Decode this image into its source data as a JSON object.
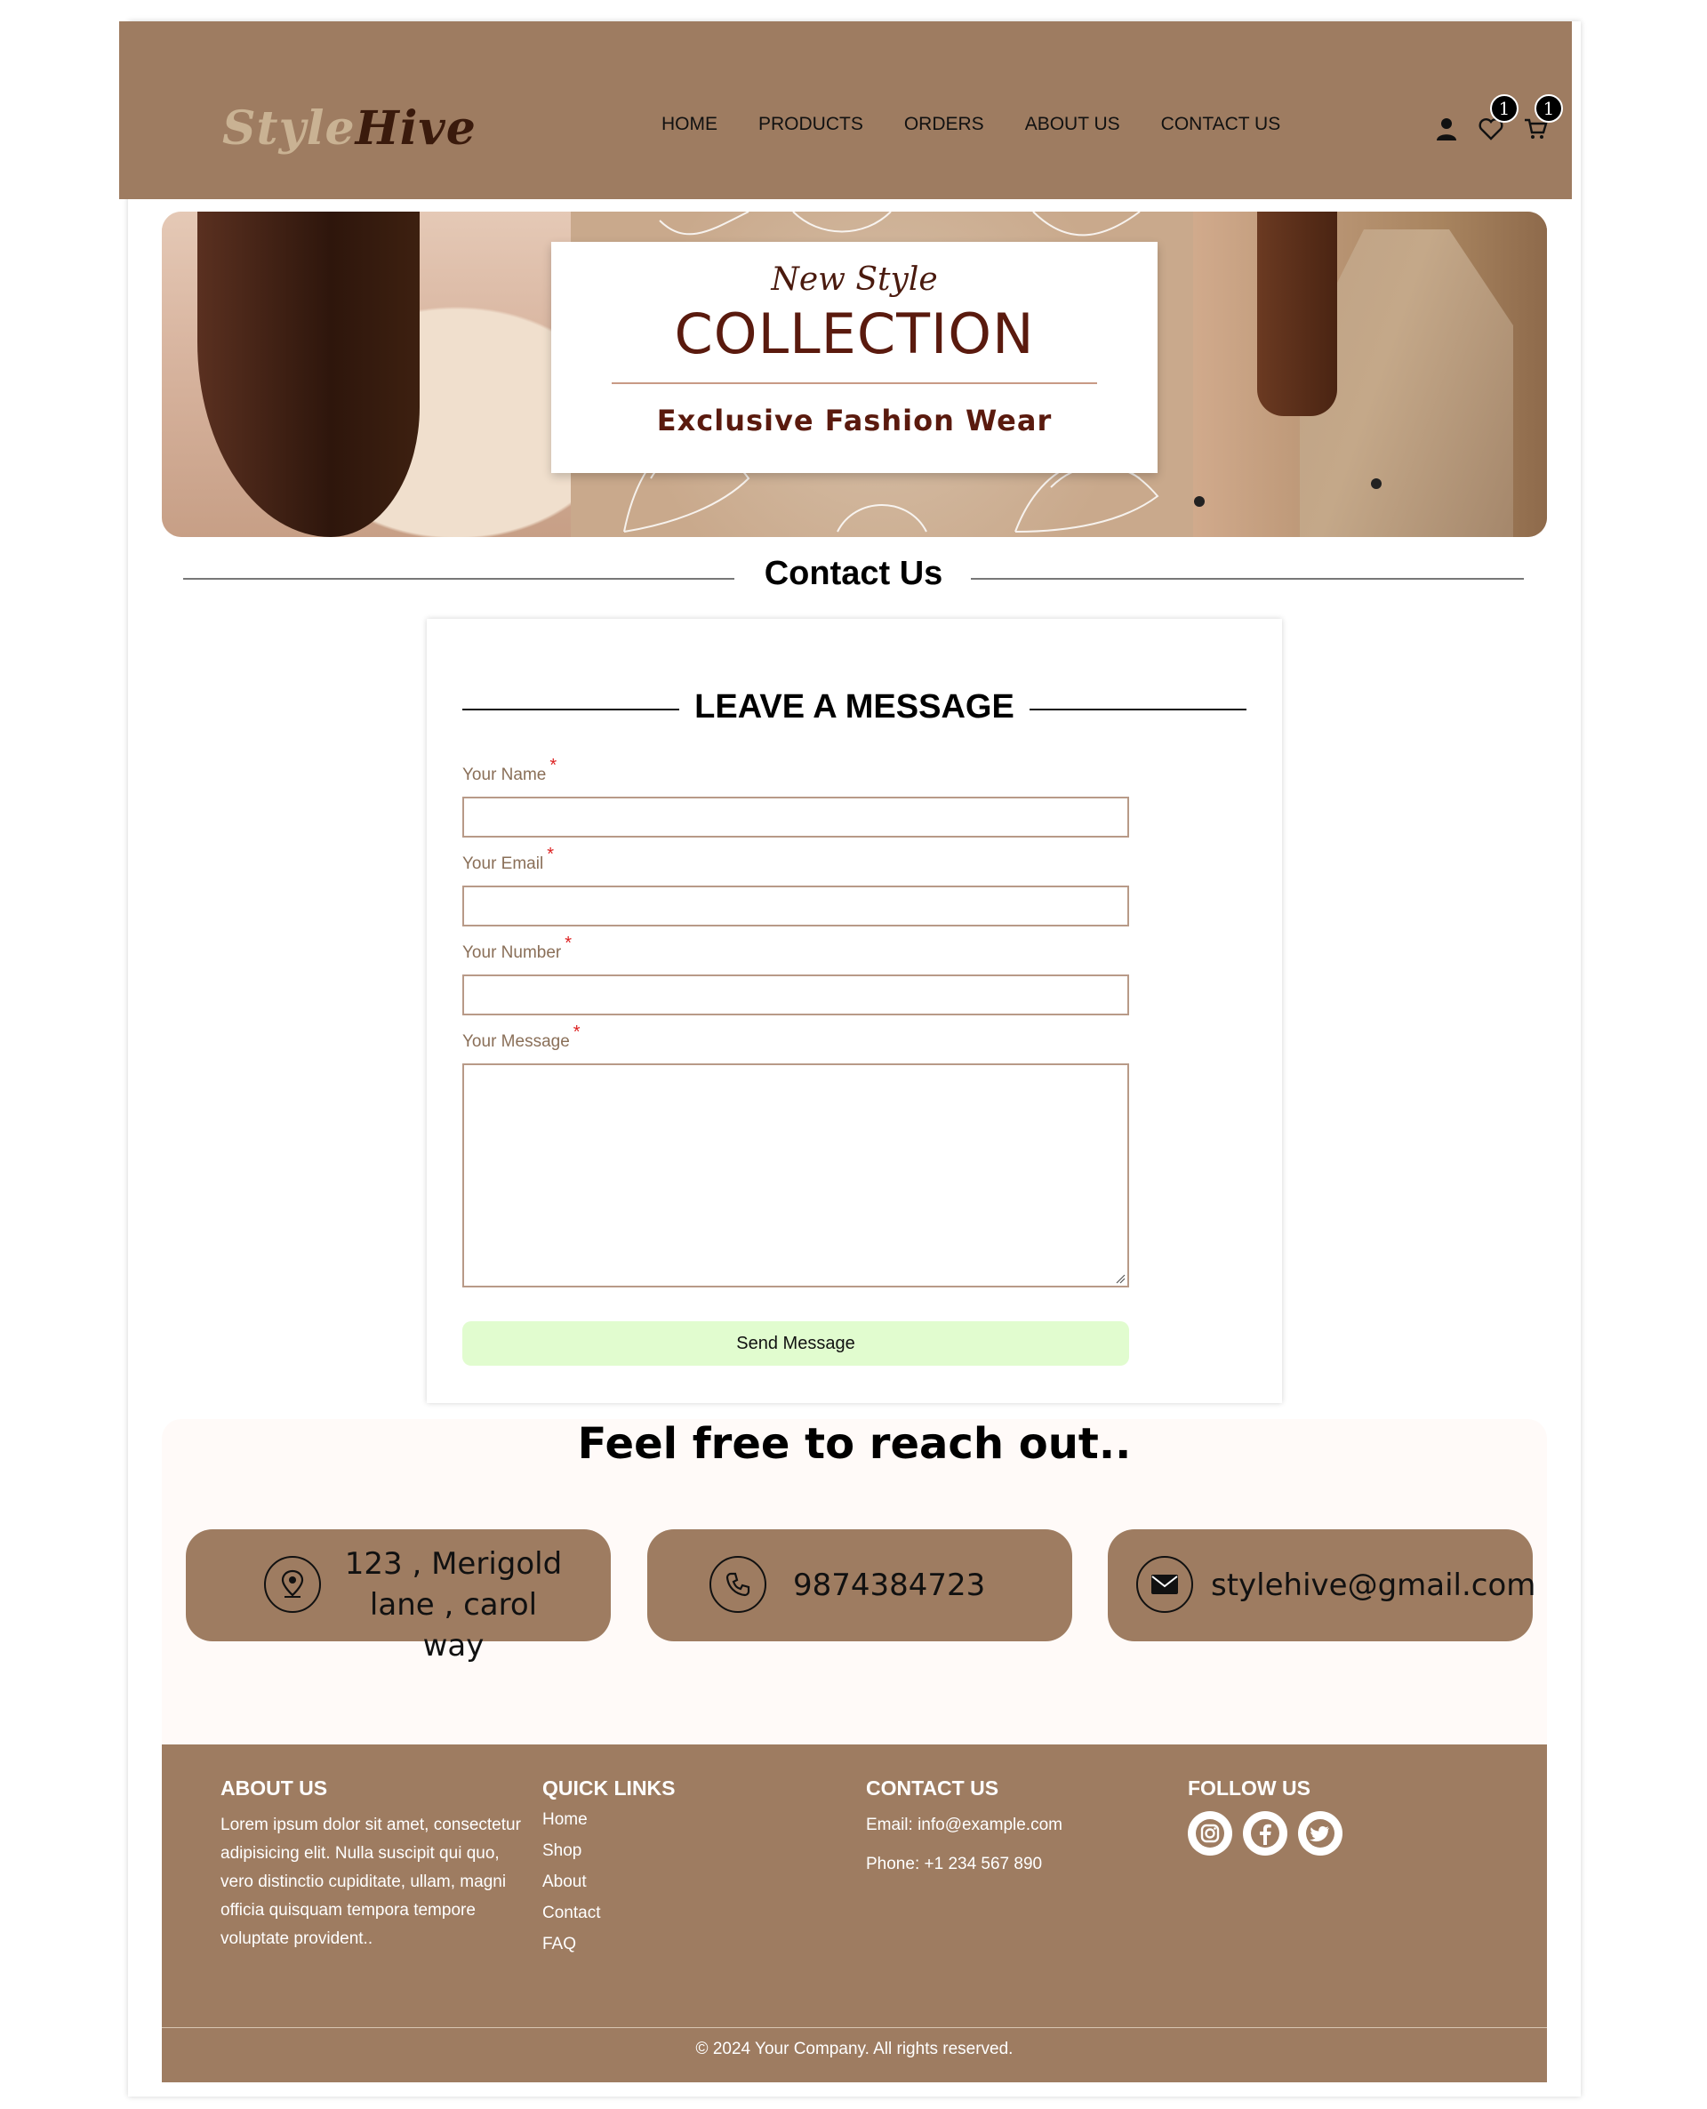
{
  "header": {
    "logo_part1": "Style",
    "logo_part2": "Hive",
    "nav": [
      "HOME",
      "PRODUCTS",
      "ORDERS",
      "ABOUT US",
      "CONTACT US"
    ],
    "wishlist_count": "1",
    "cart_count": "1",
    "icons": [
      "user-icon",
      "heart-icon",
      "cart-icon"
    ]
  },
  "hero": {
    "subtitle": "New Style",
    "title": "COLLECTION",
    "tagline": "Exclusive Fashion Wear"
  },
  "section_title": "Contact Us",
  "form": {
    "heading": "LEAVE A MESSAGE",
    "fields": [
      {
        "label": "Your Name",
        "required": "*",
        "value": ""
      },
      {
        "label": "Your Email",
        "required": "*",
        "value": ""
      },
      {
        "label": "Your Number",
        "required": "*",
        "value": ""
      },
      {
        "label": "Your Message",
        "required": "*",
        "value": ""
      }
    ],
    "submit_label": "Send Message"
  },
  "reach": {
    "title": "Feel free to reach out..",
    "address_line1": "123 ,  Merigold",
    "address_line2": "lane , carol way",
    "phone": "9874384723",
    "email": "stylehive@gmail.com"
  },
  "footer": {
    "about_title": "ABOUT US",
    "about_text": "Lorem ipsum dolor sit amet, consectetur adipisicing elit. Nulla suscipit qui quo, vero distinctio cupiditate, ullam, magni officia quisquam tempora tempore voluptate provident..",
    "links_title": "QUICK LINKS",
    "links": [
      "Home",
      "Shop",
      "About",
      "Contact",
      "FAQ"
    ],
    "contact_title": "CONTACT US",
    "contact_email": "Email: info@example.com",
    "contact_phone": "Phone: +1 234 567 890",
    "follow_title": "FOLLOW US",
    "social": [
      "instagram-icon",
      "facebook-icon",
      "twitter-icon"
    ],
    "copyright": "© 2024 Your Company. All rights reserved."
  },
  "colors": {
    "brand_brown": "#9e7c61",
    "submit_green": "#e1fccf",
    "dark_text": "#5a1a0e"
  }
}
